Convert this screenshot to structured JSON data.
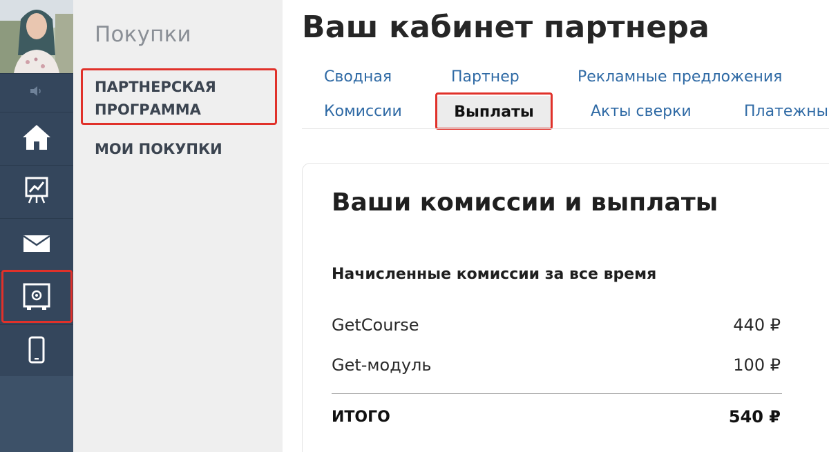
{
  "rail": {
    "icons": [
      "speaker-icon",
      "home-icon",
      "chart-board-icon",
      "mail-icon",
      "safe-icon",
      "phone-icon"
    ]
  },
  "subnav": {
    "title": "Покупки",
    "items": [
      {
        "label_line1": "ПАРТНЕРСКАЯ",
        "label_line2": "ПРОГРАММА"
      },
      {
        "label": "МОИ ПОКУПКИ"
      }
    ]
  },
  "main": {
    "title": "Ваш кабинет партнера",
    "tabs": [
      {
        "label": "Сводная"
      },
      {
        "label": "Партнер"
      },
      {
        "label": "Рекламные предложения"
      },
      {
        "label": "Комиссии"
      },
      {
        "label": "Выплаты",
        "active": true
      },
      {
        "label": "Акты сверки"
      },
      {
        "label": "Платежный"
      }
    ]
  },
  "card": {
    "title": "Ваши комиссии и выплаты",
    "section_title": "Начисленные комиссии за все время",
    "rows": [
      {
        "label": "GetCourse",
        "value": "440 ₽"
      },
      {
        "label": "Get-модуль",
        "value": "100 ₽"
      }
    ],
    "total_label": "ИТОГО",
    "total_value": "540 ₽"
  },
  "colors": {
    "rail_bg": "#34465c",
    "highlight": "#e0312a",
    "tab_link": "#2f6aa5"
  }
}
